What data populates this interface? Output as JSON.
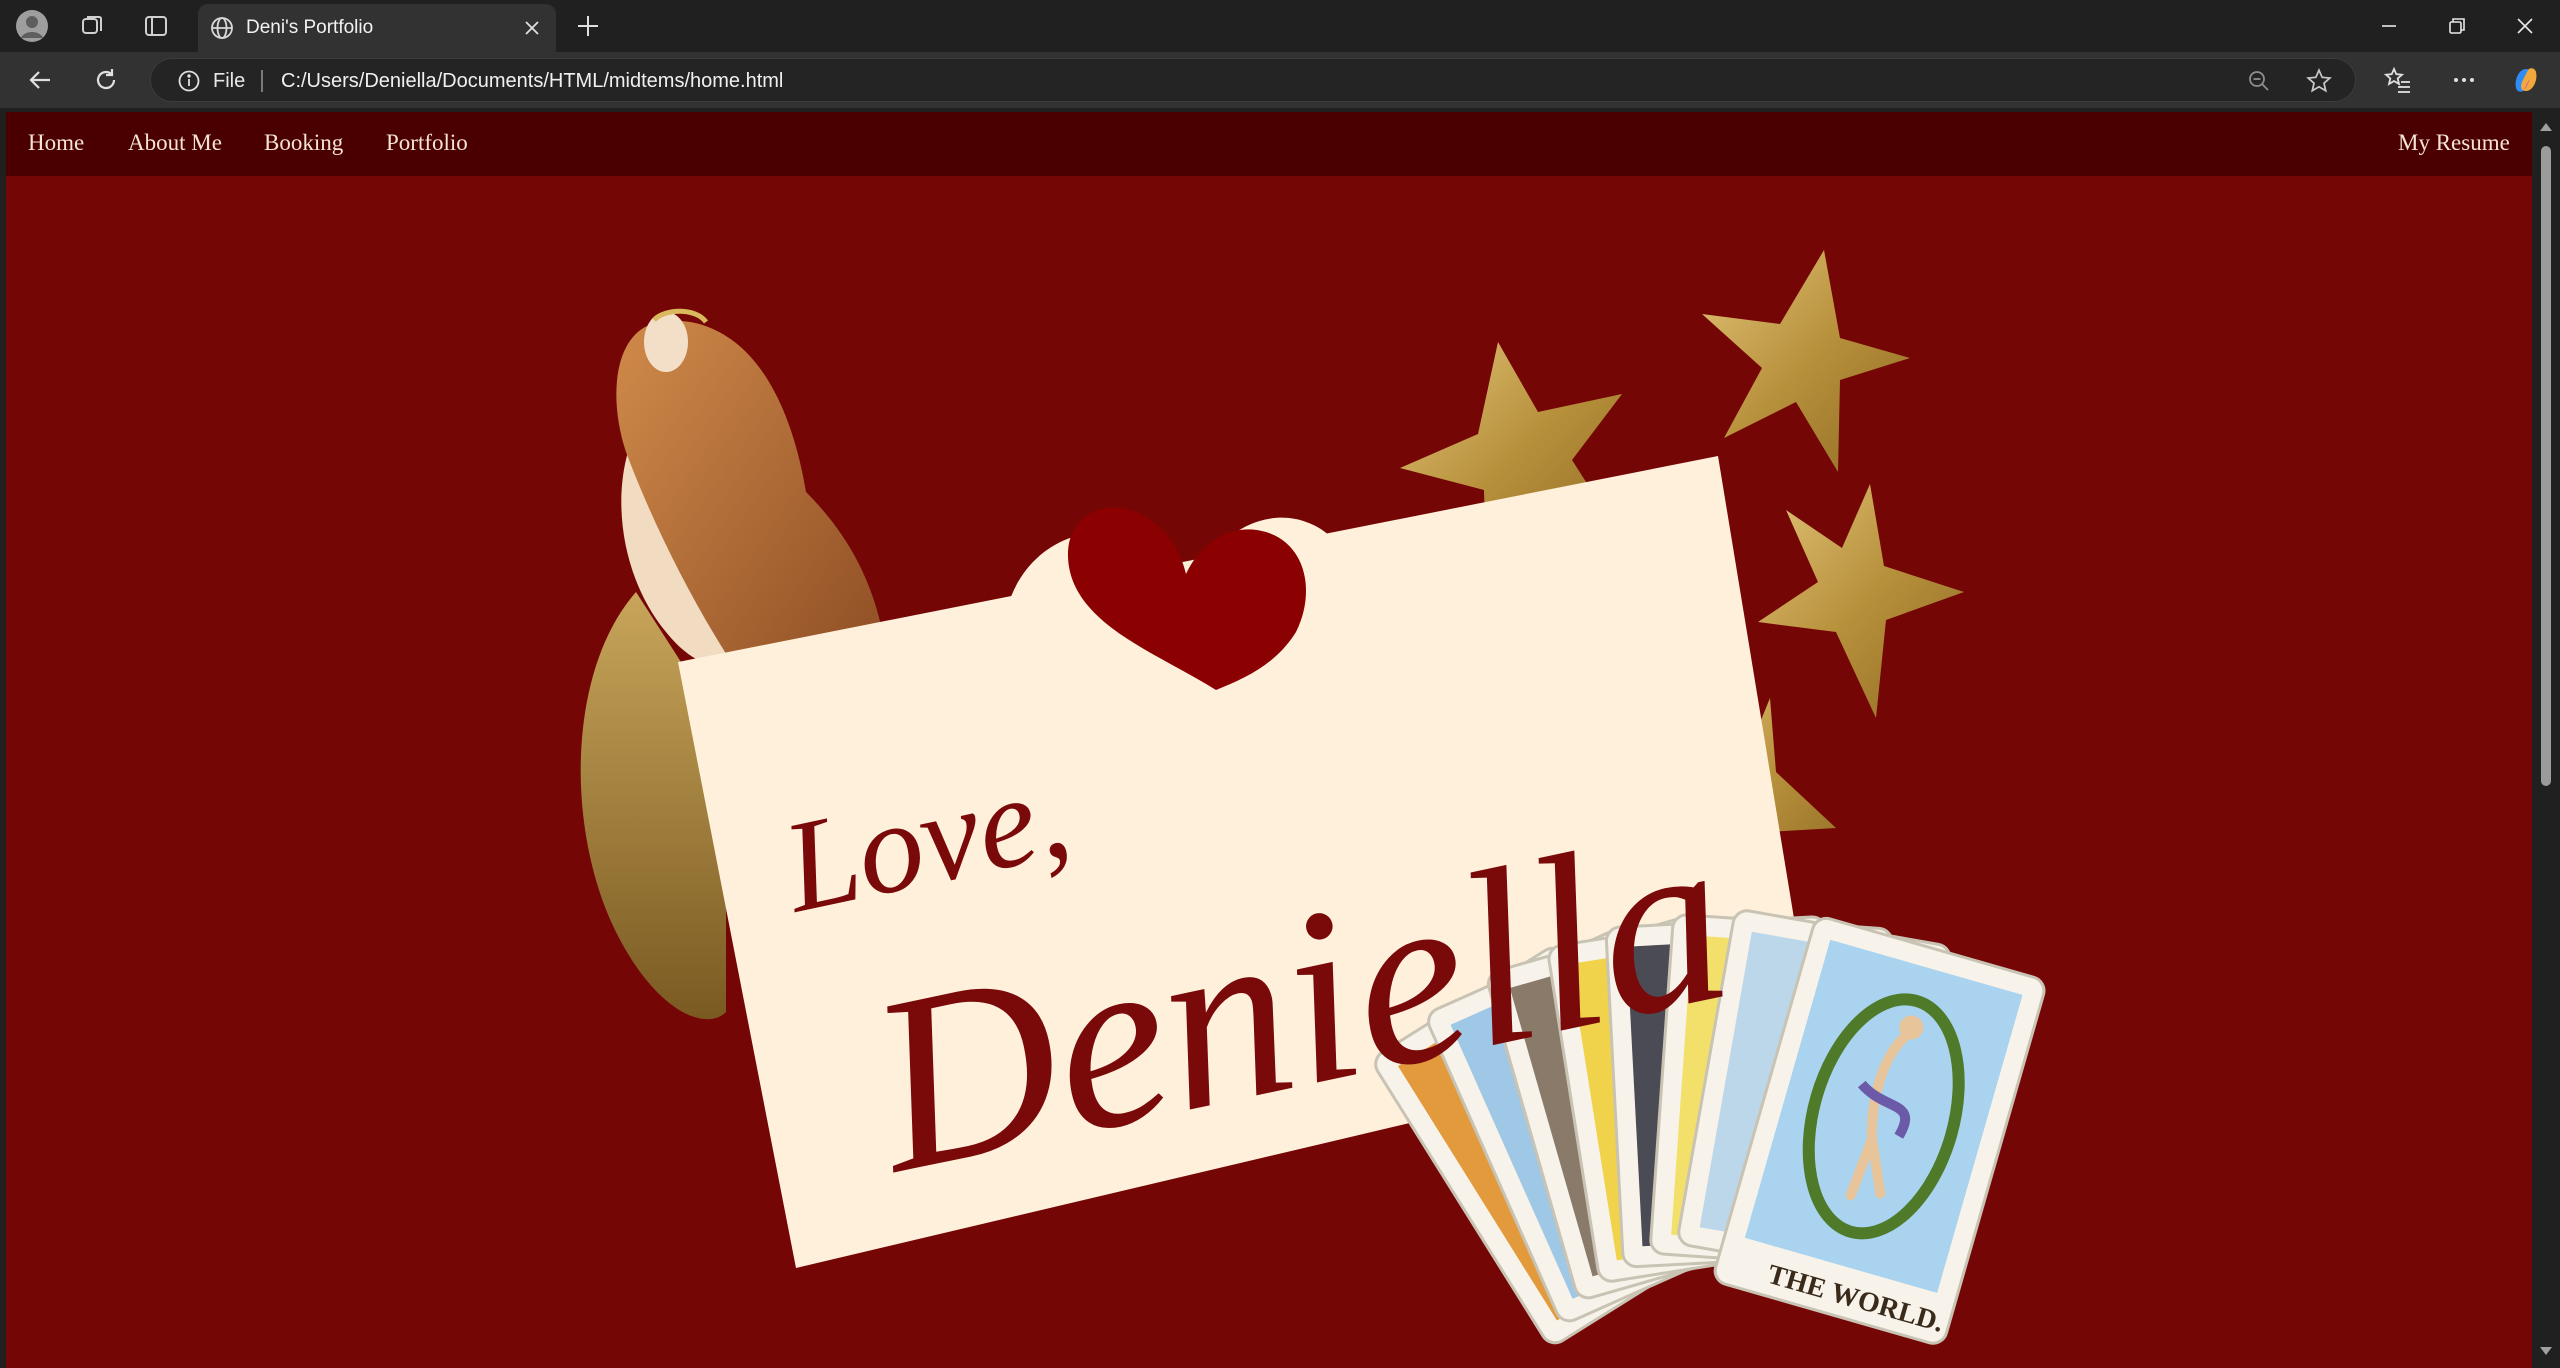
{
  "browser": {
    "tab_title": "Deni's Portfolio",
    "address_scheme": "File",
    "address_url": "C:/Users/Deniella/Documents/HTML/midtems/home.html"
  },
  "site": {
    "nav": {
      "items": [
        "Home",
        "About Me",
        "Booking",
        "Portfolio"
      ],
      "resume": "My Resume"
    },
    "hero": {
      "greeting": "Love,",
      "name": "Deniella",
      "tarot_card_caption": "THE WORLD."
    }
  },
  "colors": {
    "page_background": "#750606",
    "nav_background": "#4a0000",
    "card": "#fff0dc",
    "script_text": "#7a0a0a",
    "heart": "#8b0000",
    "gold": "#c9a44a"
  }
}
